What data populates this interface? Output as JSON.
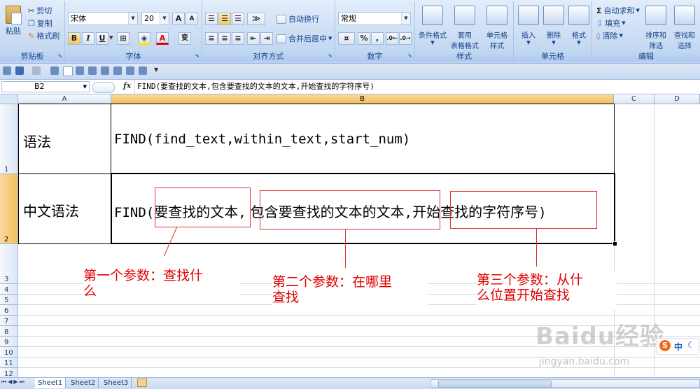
{
  "ribbon": {
    "clipboard": {
      "caption": "剪贴板",
      "paste": "粘贴",
      "cut": "剪切",
      "copy": "复制",
      "format_painter": "格式刷"
    },
    "font": {
      "caption": "字体",
      "font_name": "宋体",
      "font_size": "20",
      "grow": "A",
      "shrink": "A",
      "bold": "B",
      "italic": "I",
      "underline": "U",
      "font_color": "A",
      "phonetic": "变"
    },
    "alignment": {
      "caption": "对齐方式",
      "wrap_text": "自动换行",
      "merge_center": "合并后居中"
    },
    "number": {
      "caption": "数字",
      "format": "常规",
      "percent": "%",
      "comma": ","
    },
    "styles": {
      "caption": "样式",
      "conditional": "条件格式",
      "table_format_1": "套用",
      "table_format_2": "表格格式",
      "cell_styles_1": "单元格",
      "cell_styles_2": "样式"
    },
    "cells": {
      "caption": "单元格",
      "insert": "插入",
      "delete": "删除",
      "format": "格式"
    },
    "editing": {
      "caption": "编辑",
      "autosum": "自动求和",
      "fill": "填充",
      "clear": "清除",
      "sort_1": "排序和",
      "sort_2": "筛选",
      "find_1": "查找和",
      "find_2": "选择"
    }
  },
  "formula_bar": {
    "name_box": "B2",
    "fx": "fx",
    "formula": "FIND(要查找的文本,包含要查找的文本的文本,开始查找的字符序号)"
  },
  "grid": {
    "columns": [
      "A",
      "B",
      "C",
      "D"
    ],
    "rows": [
      "1",
      "2",
      "3",
      "4",
      "5",
      "6",
      "7",
      "8",
      "9",
      "10",
      "11",
      "12"
    ],
    "cells": {
      "A1": "语法",
      "B1": "FIND(find_text,within_text,start_num)",
      "A2": "中文语法",
      "B2_prefix": "FIND(",
      "B2_arg1": "要查找的文本",
      "B2_sep1": ",",
      "B2_arg2": "包含要查找的文本的文本",
      "B2_sep2": ",",
      "B2_arg3": "开始查找的字符序号",
      "B2_suffix": ")"
    }
  },
  "annotations": [
    {
      "line1": "第一个参数：查找什",
      "line2": "么"
    },
    {
      "line1": "第二个参数：在哪里",
      "line2": "查找"
    },
    {
      "line1": "第三个参数：从什",
      "line2": "么位置开始查找"
    }
  ],
  "sheet_tabs": [
    "Sheet1",
    "Sheet2",
    "Sheet3"
  ],
  "watermark": {
    "brand": "Baidu经验",
    "url": "jingyan.baidu.com"
  },
  "ime": {
    "logo": "S",
    "lang": "中"
  },
  "colors": {
    "selection": "#f1c05c",
    "annotation": "#e00000",
    "ribbon": "#c7daf2"
  }
}
